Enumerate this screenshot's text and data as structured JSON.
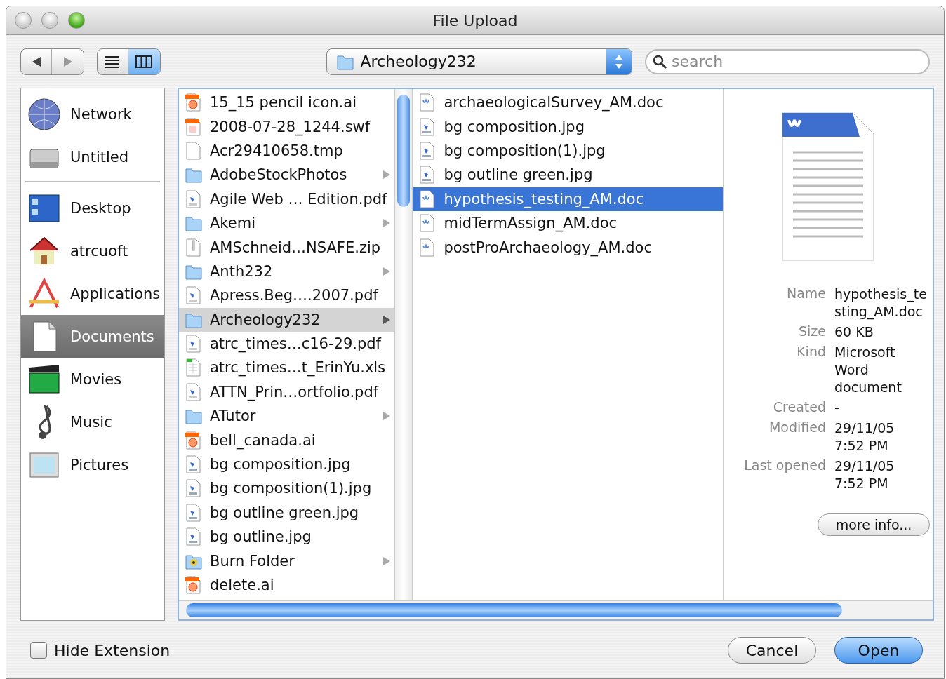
{
  "window": {
    "title": "File Upload"
  },
  "toolbar": {
    "view_buttons": [
      {
        "kind": "list",
        "selected": false
      },
      {
        "kind": "columns",
        "selected": true
      }
    ],
    "location": "Archeology232",
    "search": {
      "placeholder": "search"
    }
  },
  "sidebar": {
    "groups": [
      {
        "items": [
          {
            "label": "Network",
            "kind": "network",
            "selected": false
          },
          {
            "label": "Untitled",
            "kind": "disk",
            "selected": false
          }
        ]
      },
      {
        "items": [
          {
            "label": "Desktop",
            "kind": "desktop",
            "selected": false
          },
          {
            "label": "atrcuoft",
            "kind": "home",
            "selected": false
          },
          {
            "label": "Applications",
            "kind": "apps",
            "selected": false
          },
          {
            "label": "Documents",
            "kind": "docs",
            "selected": true
          },
          {
            "label": "Movies",
            "kind": "movies",
            "selected": false
          },
          {
            "label": "Music",
            "kind": "music",
            "selected": false
          },
          {
            "label": "Pictures",
            "kind": "pictures",
            "selected": false
          }
        ]
      }
    ]
  },
  "columns": [
    {
      "items": [
        {
          "name": "15_15 pencil icon.ai",
          "kind": "ai",
          "selected": false
        },
        {
          "name": "2008-07-28_1244.swf",
          "kind": "swf",
          "selected": false
        },
        {
          "name": "Acr29410658.tmp",
          "kind": "blank",
          "selected": false
        },
        {
          "name": "AdobeStockPhotos",
          "kind": "folder",
          "selected": false
        },
        {
          "name": "Agile Web … Edition.pdf",
          "kind": "pdf",
          "selected": false
        },
        {
          "name": "Akemi",
          "kind": "folder",
          "selected": false
        },
        {
          "name": "AMSchneid…NSAFE.zip",
          "kind": "zip",
          "selected": false
        },
        {
          "name": "Anth232",
          "kind": "folder",
          "selected": false
        },
        {
          "name": "Apress.Beg….2007.pdf",
          "kind": "pdf",
          "selected": false
        },
        {
          "name": "Archeology232",
          "kind": "folder",
          "selected": true
        },
        {
          "name": "atrc_times…c16-29.pdf",
          "kind": "pdf",
          "selected": false
        },
        {
          "name": "atrc_times…t_ErinYu.xls",
          "kind": "xls",
          "selected": false
        },
        {
          "name": "ATTN_Prin…ortfolio.pdf",
          "kind": "pdf",
          "selected": false
        },
        {
          "name": "ATutor",
          "kind": "folder",
          "selected": false
        },
        {
          "name": "bell_canada.ai",
          "kind": "ai",
          "selected": false
        },
        {
          "name": "bg composition.jpg",
          "kind": "jpg",
          "selected": false
        },
        {
          "name": "bg composition(1).jpg",
          "kind": "jpg",
          "selected": false
        },
        {
          "name": "bg outline green.jpg",
          "kind": "jpg",
          "selected": false
        },
        {
          "name": "bg outline.jpg",
          "kind": "jpg",
          "selected": false
        },
        {
          "name": "Burn Folder",
          "kind": "burn",
          "selected": false
        },
        {
          "name": "delete.ai",
          "kind": "ai",
          "selected": false
        }
      ]
    },
    {
      "items": [
        {
          "name": "archaeologicalSurvey_AM.doc",
          "kind": "doc",
          "selected": false
        },
        {
          "name": "bg composition.jpg",
          "kind": "jpg",
          "selected": false
        },
        {
          "name": "bg composition(1).jpg",
          "kind": "jpg",
          "selected": false
        },
        {
          "name": "bg outline green.jpg",
          "kind": "jpg",
          "selected": false
        },
        {
          "name": "hypothesis_testing_AM.doc",
          "kind": "doc",
          "selected": true
        },
        {
          "name": "midTermAssign_AM.doc",
          "kind": "doc",
          "selected": false
        },
        {
          "name": "postProArchaeology_AM.doc",
          "kind": "doc",
          "selected": false
        }
      ]
    }
  ],
  "preview": {
    "info": [
      {
        "label": "Name",
        "lines": [
          "hypothesis_te",
          "sting_AM.doc"
        ]
      },
      {
        "label": "Size",
        "lines": [
          "60 KB"
        ]
      },
      {
        "label": "Kind",
        "lines": [
          "Microsoft",
          "Word",
          "document"
        ]
      },
      {
        "label": "Created",
        "lines": [
          "-"
        ]
      },
      {
        "label": "Modified",
        "lines": [
          "29/11/05",
          "7:52 PM"
        ]
      },
      {
        "label": "Last opened",
        "lines": [
          "29/11/05",
          "7:52 PM"
        ]
      }
    ],
    "button": "more info..."
  },
  "hide_extension": {
    "label": "Hide Extension",
    "checked": false
  },
  "buttons": [
    {
      "label": "Cancel",
      "default": false
    },
    {
      "label": "Open",
      "default": true
    }
  ]
}
